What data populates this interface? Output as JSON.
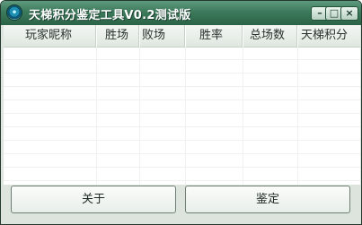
{
  "window": {
    "title": "天梯积分鉴定工具V0.2测试版",
    "controls": {
      "minimize": "–",
      "maximize": "□",
      "close": "×"
    }
  },
  "table": {
    "columns": [
      "玩家昵称",
      "胜场",
      "败场",
      "胜率",
      "总场数",
      "天梯积分"
    ],
    "rows": []
  },
  "buttons": {
    "about": "关于",
    "identify": "鉴定"
  }
}
